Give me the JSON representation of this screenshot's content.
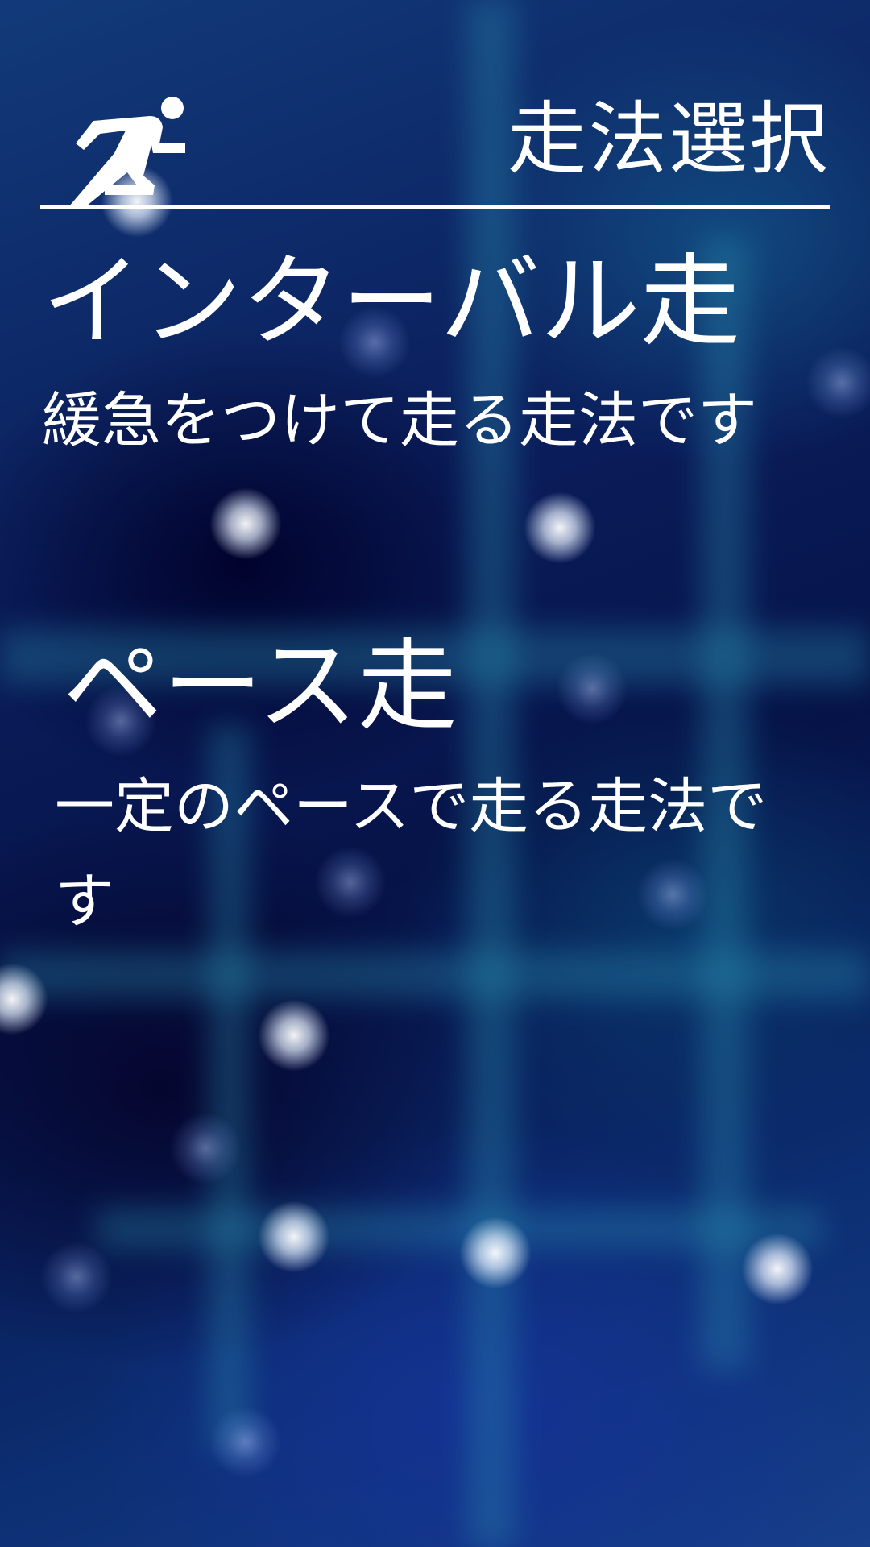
{
  "header": {
    "title": "走法選択",
    "icon": "runner-icon"
  },
  "options": [
    {
      "title": "インターバル走",
      "description": "緩急をつけて走る走法です"
    },
    {
      "title": "ペース走",
      "description": "一定のペースで走る走法です"
    }
  ],
  "colors": {
    "text": "#ffffff",
    "background": "#0a1a55"
  }
}
